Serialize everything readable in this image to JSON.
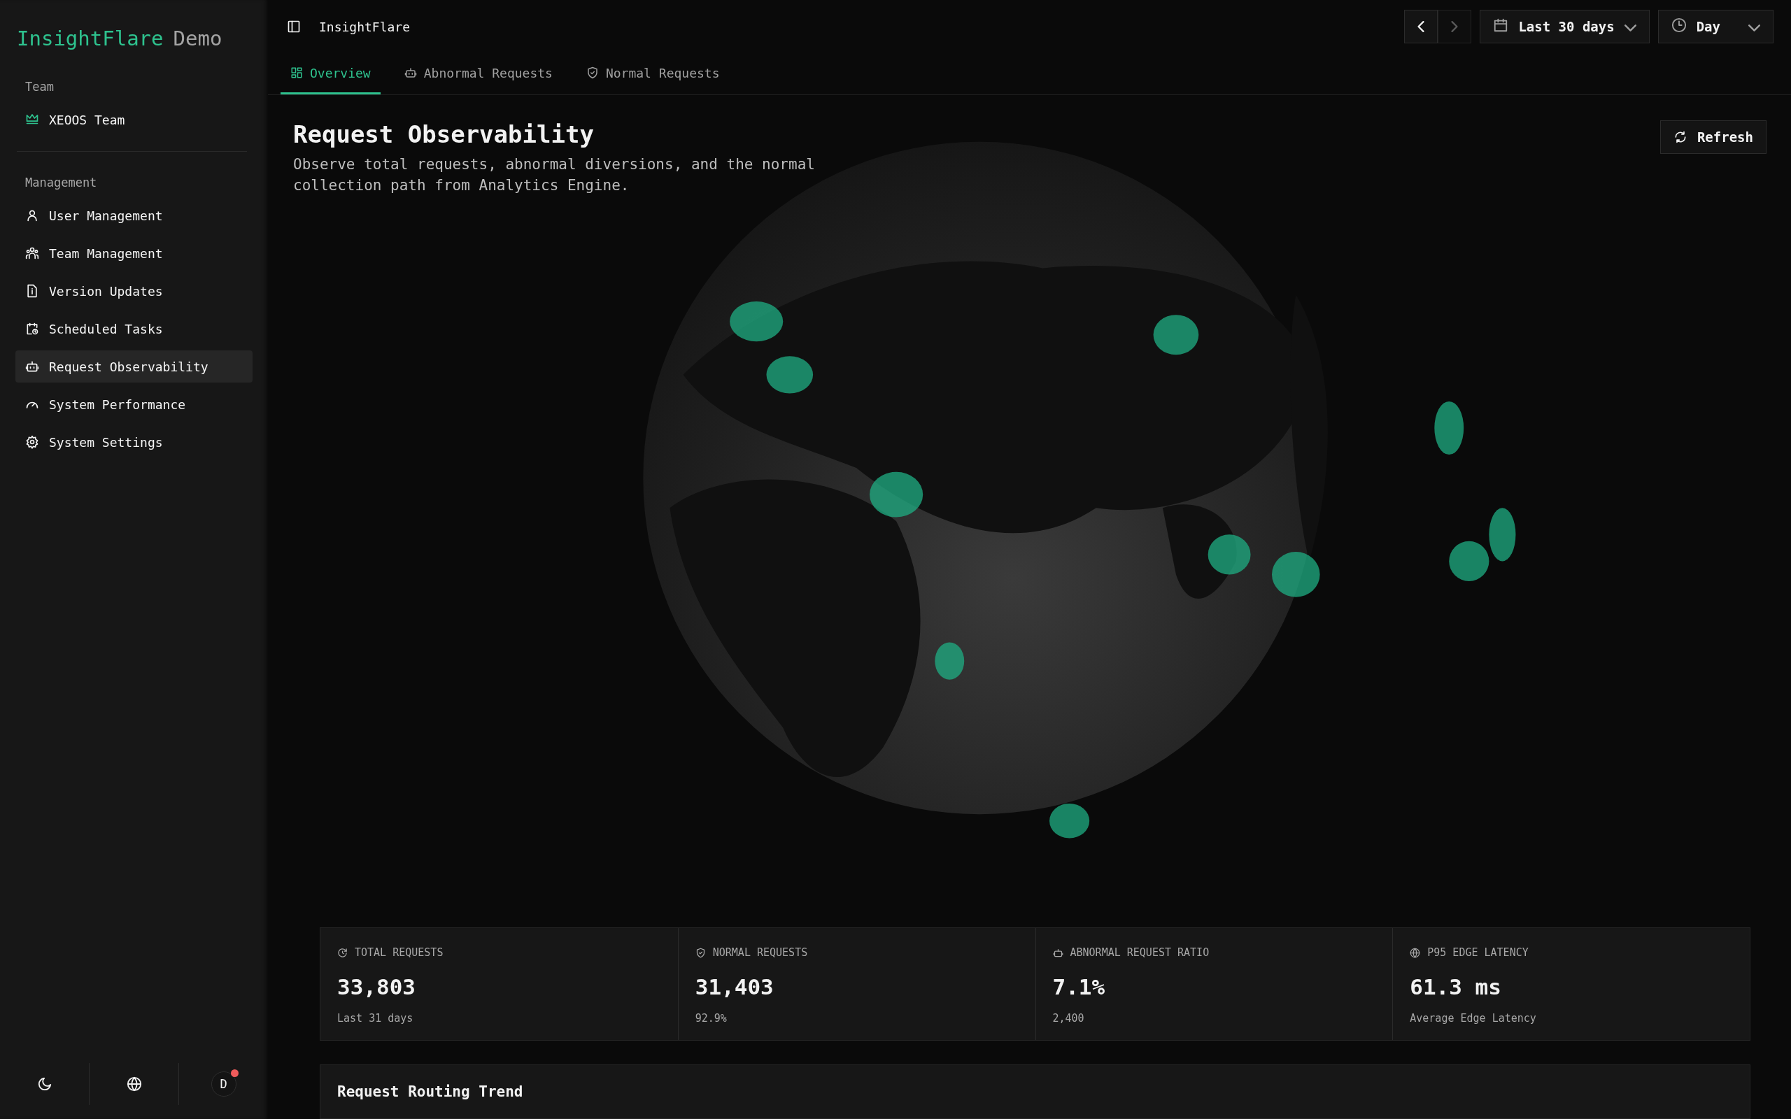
{
  "brand": {
    "name": "InsightFlare",
    "suffix": "Demo"
  },
  "sidebar": {
    "team_section": {
      "label": "Team",
      "team": "XEOOS Team"
    },
    "management_section": {
      "label": "Management",
      "items": [
        {
          "label": "User Management",
          "selected": false
        },
        {
          "label": "Team Management",
          "selected": false
        },
        {
          "label": "Version Updates",
          "selected": false
        },
        {
          "label": "Scheduled Tasks",
          "selected": false
        },
        {
          "label": "Request Observability",
          "selected": true
        },
        {
          "label": "System Performance",
          "selected": false
        },
        {
          "label": "System Settings",
          "selected": false
        }
      ]
    },
    "footer": {
      "avatar": "D",
      "notification": true
    }
  },
  "topbar": {
    "title": "InsightFlare",
    "pager": [
      {
        "kind": "prev",
        "disabled": false
      },
      {
        "kind": "next",
        "disabled": true
      }
    ],
    "range": "Last 30 days",
    "granularity": "Day"
  },
  "tabs": [
    {
      "label": "Overview",
      "selected": true
    },
    {
      "label": "Abnormal Requests",
      "selected": false
    },
    {
      "label": "Normal Requests",
      "selected": false
    }
  ],
  "page": {
    "title": "Request Observability",
    "description": "Observe total requests, abnormal diversions, and the normal collection path from Analytics Engine.",
    "refresh": "Refresh"
  },
  "stats": [
    {
      "label": "TOTAL REQUESTS",
      "value": "33,803",
      "note": "Last 31 days"
    },
    {
      "label": "NORMAL REQUESTS",
      "value": "31,403",
      "note": "92.9%"
    },
    {
      "label": "ABNORMAL REQUEST RATIO",
      "value": "7.1%",
      "note": "2,400"
    },
    {
      "label": "P95 EDGE LATENCY",
      "value": "61.3 ms",
      "note": "Average Edge Latency"
    }
  ],
  "trend": {
    "title": "Request Routing Trend"
  }
}
